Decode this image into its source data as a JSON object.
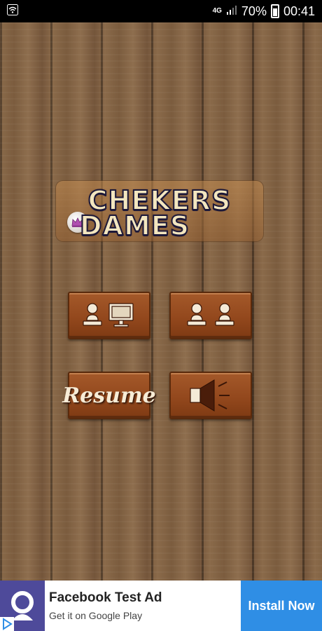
{
  "status_bar": {
    "network": "4G",
    "battery": "70%",
    "time": "00:41"
  },
  "logo": {
    "line1": "CHEKERS",
    "line2": "DAMES"
  },
  "menu": {
    "resume_label": "Resume"
  },
  "ad": {
    "title": "Facebook Test Ad",
    "subtitle": "Get it on Google Play",
    "install_label": "Install Now"
  },
  "colors": {
    "button_brown": "#93481d",
    "logo_stroke": "#1c1838",
    "ad_install_blue": "#2f8ee5",
    "ad_icon_purple": "#4e4a9a"
  }
}
